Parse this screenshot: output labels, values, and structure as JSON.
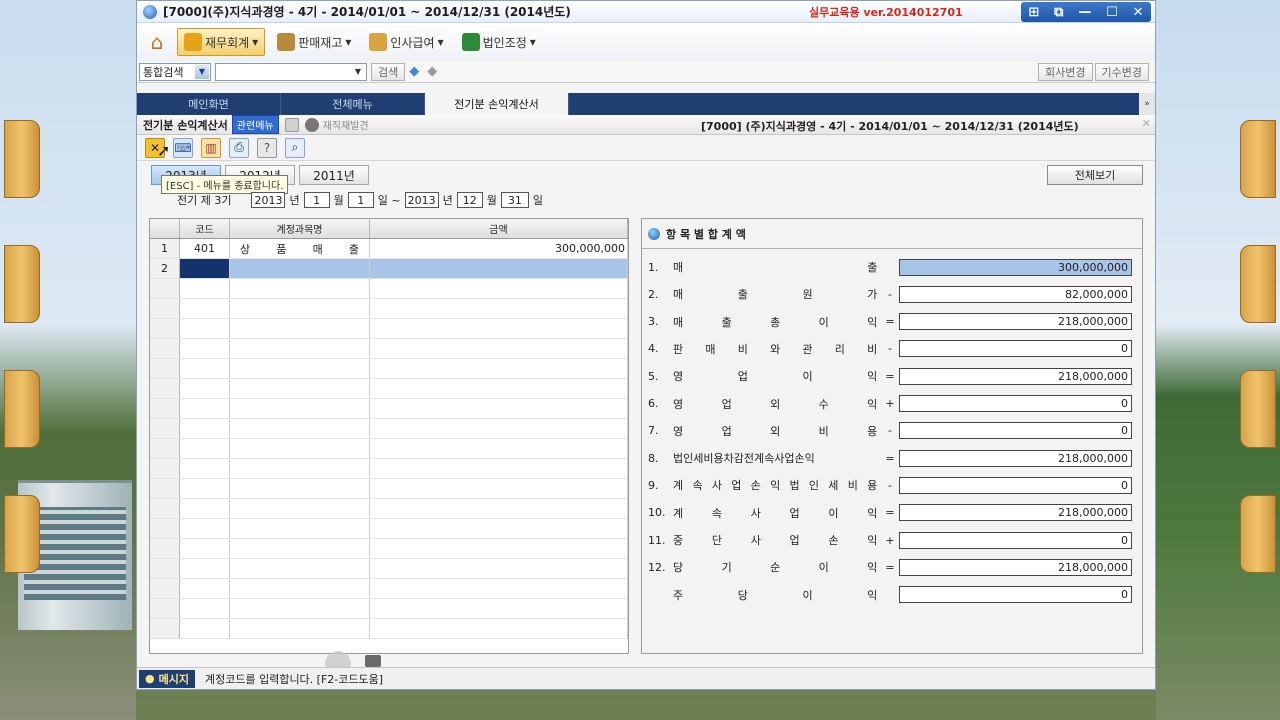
{
  "window": {
    "title": "[7000](주)지식과경영 - 4기 - 2014/01/01 ~ 2014/12/31 (2014년도)",
    "version": "실무교육용 ver.2014012701",
    "controls": [
      "⊞",
      "⧉",
      "—",
      "☐",
      "✕"
    ]
  },
  "menubar": {
    "items": [
      {
        "label": "재무회계",
        "color": "#e7a21a"
      },
      {
        "label": "판매재고",
        "color": "#b98a3b"
      },
      {
        "label": "인사급여",
        "color": "#d9a441"
      },
      {
        "label": "법인조정",
        "color": "#2e8a3a"
      }
    ]
  },
  "search": {
    "combo_label": "통합검색",
    "search_button": "검색",
    "company_change": "회사변경",
    "period_change": "기수변경"
  },
  "tabs": [
    {
      "label": "메인화면",
      "active": false
    },
    {
      "label": "전체메뉴",
      "active": false
    },
    {
      "label": "전기분 손익계산서",
      "active": true
    }
  ],
  "tabnav": "»",
  "subhead": {
    "title": "전기분 손익계산서",
    "related_menu": "관련메뉴",
    "mini_label": "재직재발견",
    "company_info": "[7000] (주)지식과경영 - 4기 - 2014/01/01 ~ 2014/12/31 (2014년도)"
  },
  "year_tabs": [
    "2013년",
    "2012년",
    "2011년"
  ],
  "tooltip": "[ESC] - 메뉴를 종료합니다.",
  "full_view_button": "전체보기",
  "period": {
    "prefix": "전기 제 3기",
    "start_year": "2013",
    "year_unit": "년",
    "start_month": "1",
    "month_unit": "월",
    "start_day": "1",
    "day_unit": "일 ~",
    "end_year": "2013",
    "end_month": "12",
    "end_day": "31",
    "end_day_unit": "일"
  },
  "grid": {
    "headers": [
      "코드",
      "계정과목명",
      "금액"
    ],
    "rows": [
      {
        "no": "1",
        "code": "401",
        "name": [
          "상",
          "품",
          "매",
          "출"
        ],
        "amount": "300,000,000"
      },
      {
        "no": "2",
        "code": "",
        "name": [],
        "amount": ""
      }
    ]
  },
  "summary": {
    "title": "항 목 별 합 계 액",
    "items": [
      {
        "no": "1.",
        "label": [
          "매",
          "출"
        ],
        "op": "",
        "value": "300,000,000",
        "highlight": true
      },
      {
        "no": "2.",
        "label": [
          "매",
          "출",
          "원",
          "가"
        ],
        "op": "-",
        "value": "82,000,000",
        "highlight": false
      },
      {
        "no": "3.",
        "label": [
          "매",
          "출",
          "총",
          "이",
          "익"
        ],
        "op": "=",
        "value": "218,000,000",
        "highlight": false
      },
      {
        "no": "4.",
        "label": [
          "판",
          "매",
          "비",
          "와",
          "관",
          "리",
          "비"
        ],
        "op": "-",
        "value": "0",
        "highlight": false
      },
      {
        "no": "5.",
        "label": [
          "영",
          "업",
          "이",
          "익"
        ],
        "op": "=",
        "value": "218,000,000",
        "highlight": false
      },
      {
        "no": "6.",
        "label": [
          "영",
          "업",
          "외",
          "수",
          "익"
        ],
        "op": "+",
        "value": "0",
        "highlight": false
      },
      {
        "no": "7.",
        "label": [
          "영",
          "업",
          "외",
          "비",
          "용"
        ],
        "op": "-",
        "value": "0",
        "highlight": false
      },
      {
        "no": "8.",
        "label": [
          "법인세비용차감전계속사업손익"
        ],
        "op": "=",
        "value": "218,000,000",
        "highlight": false
      },
      {
        "no": "9.",
        "label": [
          "계",
          "속",
          "사",
          "업",
          "손",
          "익",
          "법",
          "인",
          "세",
          "비",
          "용"
        ],
        "op": "-",
        "value": "0",
        "highlight": false
      },
      {
        "no": "10.",
        "label": [
          "계",
          "속",
          "사",
          "업",
          "이",
          "익"
        ],
        "op": "=",
        "value": "218,000,000",
        "highlight": false
      },
      {
        "no": "11.",
        "label": [
          "중",
          "단",
          "사",
          "업",
          "손",
          "익"
        ],
        "op": "+",
        "value": "0",
        "highlight": false
      },
      {
        "no": "12.",
        "label": [
          "당",
          "기",
          "순",
          "이",
          "익"
        ],
        "op": "=",
        "value": "218,000,000",
        "highlight": false
      },
      {
        "no": "",
        "label": [
          "주",
          "당",
          "이",
          "익"
        ],
        "op": "",
        "value": "0",
        "highlight": false
      }
    ]
  },
  "status": {
    "badge": "메시지",
    "message": "계정코드를 입력합니다. [F2-코드도움]"
  }
}
